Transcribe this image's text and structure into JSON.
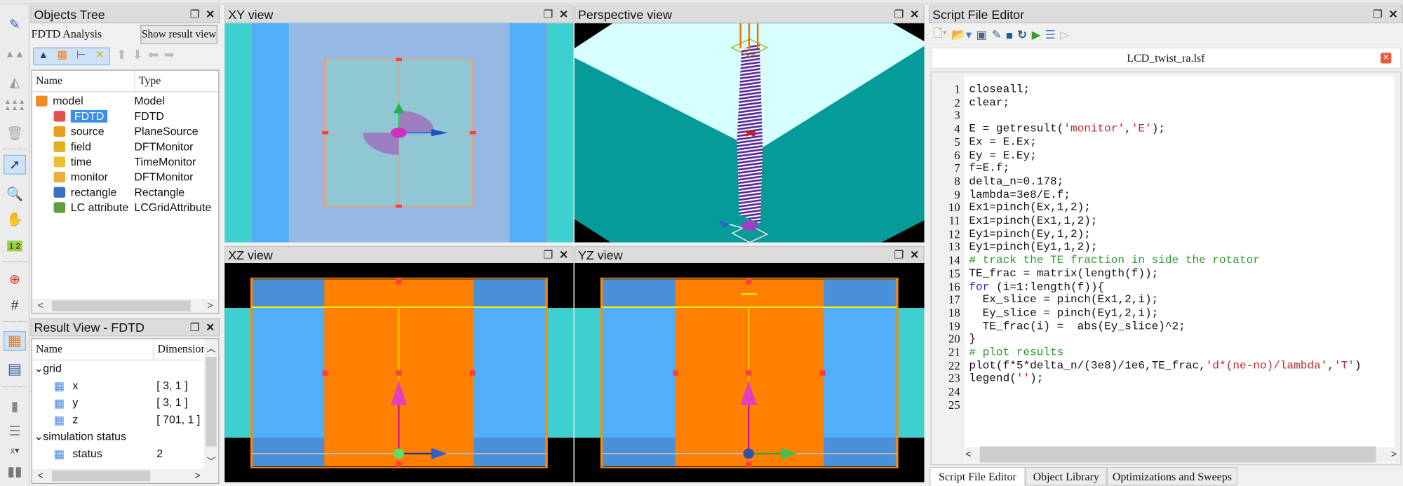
{
  "left_toolbar": {
    "icons": [
      "pencil-icon",
      "double-triangle-icon",
      "mountain-icon",
      "pyramid-array-icon",
      "trash-icon",
      "select-arrow-icon",
      "magnifier-icon",
      "hand-icon",
      "ruler-icon",
      "zoom-move-icon",
      "grid-pencil-icon",
      "grid-icon",
      "calculator-icon",
      "bar-icon",
      "align-icon",
      "axis-dropdown-icon",
      "bars-icon"
    ],
    "axis_label": "x",
    "ruler_label": "1 2"
  },
  "objects_tree": {
    "title": "Objects Tree",
    "analysis_label": "FDTD Analysis",
    "show_result_button": "Show result view",
    "columns": [
      "Name",
      "Type"
    ],
    "items": [
      {
        "name": "model",
        "type": "Model",
        "icon": "model-icon",
        "color": "#f08a24",
        "level": 0
      },
      {
        "name": "FDTD",
        "type": "FDTD",
        "icon": "fdtd-icon",
        "color": "#e05050",
        "level": 1,
        "selected": true
      },
      {
        "name": "source",
        "type": "PlaneSource",
        "icon": "source-icon",
        "color": "#e8a020",
        "level": 1
      },
      {
        "name": "field",
        "type": "DFTMonitor",
        "icon": "monitor-icon",
        "color": "#e0b020",
        "level": 1
      },
      {
        "name": "time",
        "type": "TimeMonitor",
        "icon": "clock-icon",
        "color": "#f0c030",
        "level": 1
      },
      {
        "name": "monitor",
        "type": "DFTMonitor",
        "icon": "monitor-icon",
        "color": "#e8b040",
        "level": 1
      },
      {
        "name": "rectangle",
        "type": "Rectangle",
        "icon": "rectangle-icon",
        "color": "#3a70c0",
        "level": 1
      },
      {
        "name": "LC attribute",
        "type": "LCGridAttribute",
        "icon": "lc-attribute-icon",
        "color": "#60a040",
        "level": 1
      }
    ]
  },
  "result_view": {
    "title": "Result View - FDTD",
    "columns": [
      "Name",
      "Dimension"
    ],
    "rows": [
      {
        "name": "grid",
        "dim": "",
        "group": true
      },
      {
        "name": "x",
        "dim": "[ 3, 1 ]"
      },
      {
        "name": "y",
        "dim": "[ 3, 1 ]"
      },
      {
        "name": "z",
        "dim": "[ 701, 1 ]"
      },
      {
        "name": "simulation status",
        "dim": "",
        "group": true
      },
      {
        "name": "status",
        "dim": "2"
      }
    ]
  },
  "views": {
    "xy": "XY view",
    "perspective": "Perspective view",
    "xz": "XZ view",
    "yz": "YZ view"
  },
  "script_editor": {
    "title": "Script File Editor",
    "toolbar_icons": [
      "new-file-icon",
      "open-file-icon",
      "save-icon",
      "save-as-icon",
      "save-folder-icon",
      "refresh-icon",
      "run-script-icon",
      "split-icon",
      "next-icon"
    ],
    "file_tab": "LCD_twist_ra.lsf",
    "lines": [
      "closeall;",
      "clear;",
      "",
      "E = getresult('monitor','E');",
      "Ex = E.Ex;",
      "Ey = E.Ey;",
      "f=E.f;",
      "delta_n=0.178;",
      "lambda=3e8/E.f;",
      "Ex1=pinch(Ex,1,2);",
      "Ex1=pinch(Ex1,1,2);",
      "Ey1=pinch(Ey,1,2);",
      "Ey1=pinch(Ey1,1,2);",
      "# track the TE fraction in side the rotator",
      "TE_frac = matrix(length(f));",
      "for (i=1:length(f)){",
      "  Ex_slice = pinch(Ex1,2,i);",
      "  Ey_slice = pinch(Ey1,2,i);",
      "  TE_frac(i) =  abs(Ey_slice)^2;",
      "}",
      "# plot results",
      "plot(f*5*delta_n/(3e8)/1e6,TE_frac,'d*(ne-no)/lambda','T')",
      "legend('');",
      "",
      ""
    ],
    "bottom_tabs": [
      "Script File Editor",
      "Object Library",
      "Optimizations and Sweeps"
    ]
  },
  "colors": {
    "selection": "#3b8fe8",
    "cyan": "#3dd0cf",
    "blue": "#51aef7",
    "orange": "#ff8000",
    "teal": "#049b98"
  }
}
